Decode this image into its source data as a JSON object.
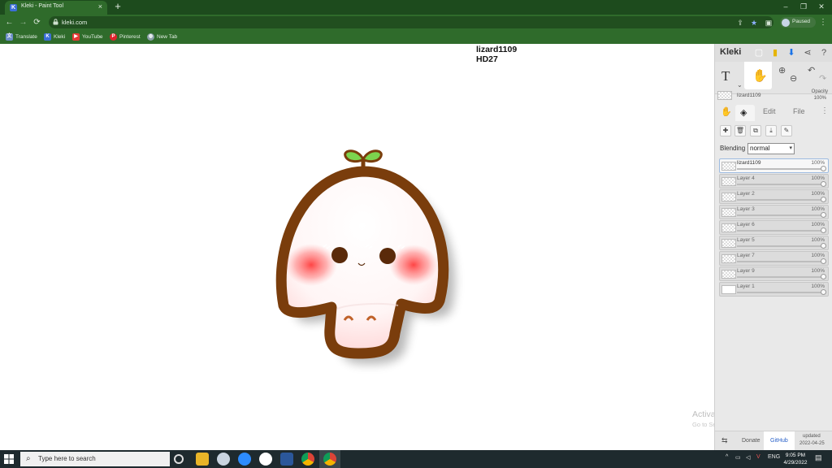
{
  "browser": {
    "tab_title": "Kleki - Paint Tool",
    "tab_close": "×",
    "new_tab": "+",
    "url": "kleki.com",
    "profile_status": "Paused",
    "window_controls": {
      "minimize": "–",
      "restore": "❐",
      "close": "✕"
    },
    "nav": {
      "back": "←",
      "forward": "→",
      "reload": "⟳"
    },
    "bookmarks": [
      {
        "label": "Translate",
        "icon": "translate-icon",
        "color": "#6c8ec9"
      },
      {
        "label": "Kleki",
        "icon": "kleki-icon",
        "color": "#3b6fd6"
      },
      {
        "label": "YouTube",
        "icon": "youtube-icon",
        "color": "#e53935"
      },
      {
        "label": "Pinterest",
        "icon": "pinterest-icon",
        "color": "#e0232d"
      },
      {
        "label": "New Tab",
        "icon": "globe-icon",
        "color": "#8aa0a8"
      }
    ]
  },
  "canvas": {
    "author_line1": "lizard1109",
    "author_line2": "HD27",
    "artwork": "cute mushroom with sprout"
  },
  "kleki": {
    "logo": "Kleki",
    "text_tool": "T",
    "layer_name_top": "lizard1109",
    "opacity_label": "Opacity",
    "opacity_value": "100%",
    "tabs": {
      "edit": "Edit",
      "file": "File"
    },
    "blending_label": "Blending",
    "blending_value": "normal",
    "layers": [
      {
        "name": "lizard1109",
        "opacity": "100%",
        "active": true
      },
      {
        "name": "Layer 4",
        "opacity": "100%",
        "active": false
      },
      {
        "name": "Layer 2",
        "opacity": "100%",
        "active": false
      },
      {
        "name": "Layer 3",
        "opacity": "100%",
        "active": false
      },
      {
        "name": "Layer 6",
        "opacity": "100%",
        "active": false
      },
      {
        "name": "Layer 5",
        "opacity": "100%",
        "active": false
      },
      {
        "name": "Layer 7",
        "opacity": "100%",
        "active": false
      },
      {
        "name": "Layer 9",
        "opacity": "100%",
        "active": false
      },
      {
        "name": "Layer 1",
        "opacity": "100%",
        "active": false
      }
    ],
    "footer": {
      "donate": "Donate",
      "github": "GitHub",
      "updated_label": "updated",
      "updated_date": "2022-04-25"
    }
  },
  "watermark": {
    "line1": "Activate Windows",
    "line2": "Go to Settings to activate Windows."
  },
  "taskbar": {
    "search_placeholder": "Type here to search",
    "language": "ENG",
    "time": "9:05 PM",
    "date": "4/29/2022"
  },
  "colors": {
    "chrome_dark": "#1d4b1d",
    "chrome": "#2f6b2b",
    "mushroom_outline": "#7a3d0c",
    "blush": "#ff4a4a",
    "sprout": "#5bbf3a"
  }
}
